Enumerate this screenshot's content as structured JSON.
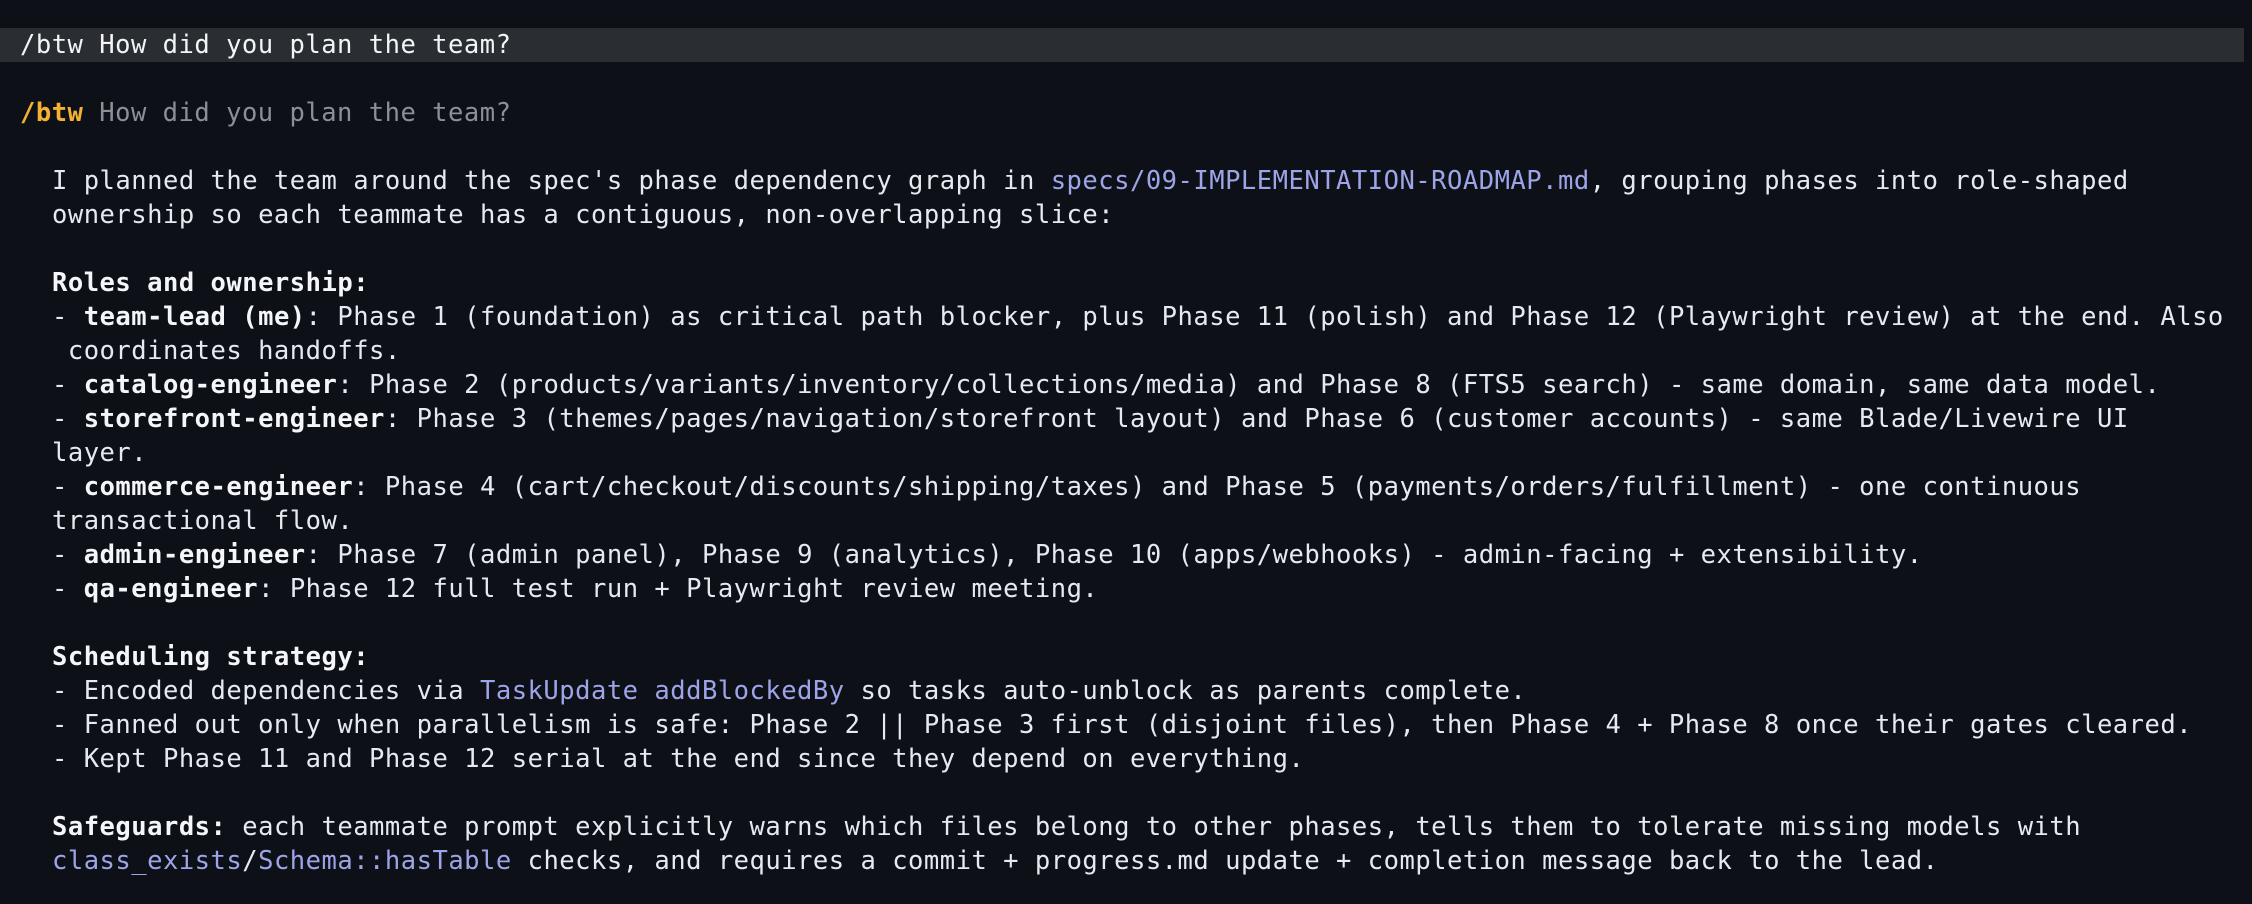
{
  "input": {
    "command_text": "/btw How did you plan the team?"
  },
  "echo": {
    "command": "/btw",
    "question": " How did you plan the team?"
  },
  "response": {
    "intro": {
      "l1_a": "I planned the team around the spec's phase dependency graph in ",
      "l1_link": "specs/09-IMPLEMENTATION-ROADMAP.md",
      "l1_b": ", grouping phases into role-shaped",
      "l2": "ownership so each teammate has a contiguous, non-overlapping slice:"
    },
    "roles": {
      "heading": "Roles and ownership:",
      "items": [
        {
          "prefix": "- ",
          "name": "team-lead (me)",
          "line1": ": Phase 1 (foundation) as critical path blocker, plus Phase 11 (polish) and Phase 12 (Playwright review) at the end. Also",
          "line2": " coordinates handoffs."
        },
        {
          "prefix": "- ",
          "name": "catalog-engineer",
          "line1": ": Phase 2 (products/variants/inventory/collections/media) and Phase 8 (FTS5 search) - same domain, same data model."
        },
        {
          "prefix": "- ",
          "name": "storefront-engineer",
          "line1": ": Phase 3 (themes/pages/navigation/storefront layout) and Phase 6 (customer accounts) - same Blade/Livewire UI",
          "line2": "layer."
        },
        {
          "prefix": "- ",
          "name": "commerce-engineer",
          "line1": ": Phase 4 (cart/checkout/discounts/shipping/taxes) and Phase 5 (payments/orders/fulfillment) - one continuous",
          "line2": "transactional flow."
        },
        {
          "prefix": "- ",
          "name": "admin-engineer",
          "line1": ": Phase 7 (admin panel), Phase 9 (analytics), Phase 10 (apps/webhooks) - admin-facing + extensibility."
        },
        {
          "prefix": "- ",
          "name": "qa-engineer",
          "line1": ": Phase 12 full test run + Playwright review meeting."
        }
      ]
    },
    "scheduling": {
      "heading": "Scheduling strategy:",
      "i1_a": "- Encoded dependencies via ",
      "i1_link": "TaskUpdate addBlockedBy",
      "i1_b": " so tasks auto-unblock as parents complete.",
      "i2": "- Fanned out only when parallelism is safe: Phase 2 || Phase 3 first (disjoint files), then Phase 4 + Phase 8 once their gates cleared.",
      "i3": "- Kept Phase 11 and Phase 12 serial at the end since they depend on everything."
    },
    "safeguards": {
      "label": "Safeguards:",
      "l1": " each teammate prompt explicitly warns which files belong to other phases, tells them to tolerate missing models with",
      "link1": "class_exists",
      "sep": "/",
      "link2": "Schema::hasTable",
      "l2": " checks, and requires a commit + progress.md update + completion message back to the lead."
    }
  },
  "colors": {
    "background": "#0d1117",
    "input_bar": "#2a2d31",
    "command_accent": "#f5b133",
    "link": "#9ea4e8",
    "muted": "#8b8f96",
    "text": "#e6e9ef"
  }
}
